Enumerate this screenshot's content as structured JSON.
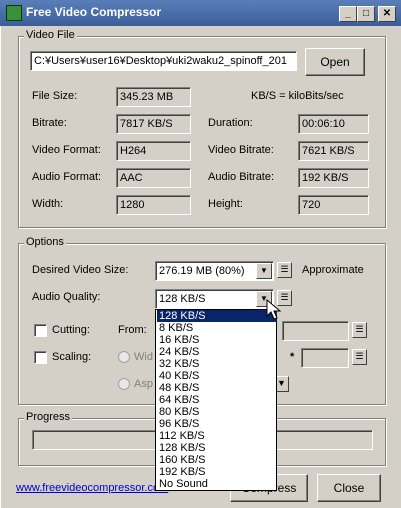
{
  "window": {
    "title": "Free Video Compressor",
    "controls": {
      "minimize": "_",
      "maximize": "□",
      "close": "✕"
    }
  },
  "video_file": {
    "group_title": "Video File",
    "path": "C:¥Users¥user16¥Desktop¥uki2waku2_spinoff_201",
    "open_label": "Open",
    "file_size_label": "File Size:",
    "file_size": "345.23 MB",
    "kbs_note": "KB/S = kiloBits/sec",
    "bitrate_label": "Bitrate:",
    "bitrate": "7817 KB/S",
    "duration_label": "Duration:",
    "duration": "00:06:10",
    "video_format_label": "Video Format:",
    "video_format": "H264",
    "video_bitrate_label": "Video Bitrate:",
    "video_bitrate": "7621 KB/S",
    "audio_format_label": "Audio Format:",
    "audio_format": "AAC",
    "audio_bitrate_label": "Audio Bitrate:",
    "audio_bitrate": "192 KB/S",
    "width_label": "Width:",
    "width": "1280",
    "height_label": "Height:",
    "height": "720"
  },
  "options": {
    "group_title": "Options",
    "desired_size_label": "Desired Video Size:",
    "desired_size": "276.19 MB (80%)",
    "approximate_label": "Approximate",
    "audio_quality_label": "Audio Quality:",
    "audio_quality": "128 KB/S",
    "cutting_label": "Cutting:",
    "from_label": "From:",
    "scaling_label": "Scaling:",
    "width_radio_label": "Wid",
    "aspect_radio_label": "Asp",
    "times_sign": "*"
  },
  "progress": {
    "group_title": "Progress"
  },
  "footer": {
    "link": "www.freevideocompressor.com",
    "compress_label": "Compress",
    "close_label": "Close"
  },
  "audio_dropdown": {
    "selected": "128 KB/S",
    "options": [
      "128 KB/S",
      "8 KB/S",
      "16 KB/S",
      "24 KB/S",
      "32 KB/S",
      "40 KB/S",
      "48 KB/S",
      "64 KB/S",
      "80 KB/S",
      "96 KB/S",
      "112 KB/S",
      "128 KB/S",
      "160 KB/S",
      "192 KB/S",
      "No Sound"
    ]
  }
}
